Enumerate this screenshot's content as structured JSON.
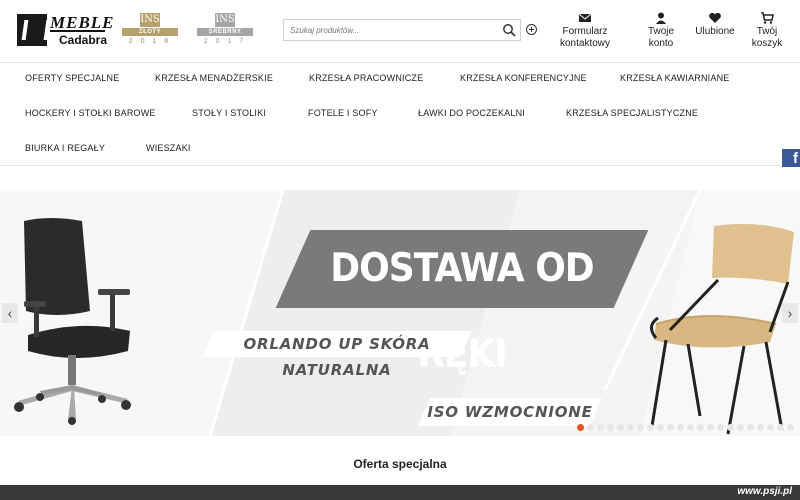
{
  "logo": {
    "line1": "MEBLE",
    "line2": "Cadabra"
  },
  "badges": [
    {
      "ins": "INS",
      "label": "ZŁOTY PARTNER",
      "year": "2 0 1 8"
    },
    {
      "ins": "INS",
      "label": "SREBRNY PARTNER",
      "year": "2 0 1 7"
    }
  ],
  "search": {
    "placeholder": "Szukaj produktów...",
    "value": ""
  },
  "header_links": {
    "contact": {
      "line1": "Formularz",
      "line2": "kontaktowy",
      "icon": "envelope-icon"
    },
    "account": {
      "line1": "Twoje",
      "line2": "konto",
      "icon": "user-icon"
    },
    "favorites": {
      "line1": "Ulubione",
      "icon": "heart-icon"
    },
    "cart": {
      "line1": "Twój",
      "line2": "koszyk",
      "icon": "cart-icon"
    }
  },
  "nav": [
    "OFERTY SPECJALNE",
    "KRZESŁA MENADŻERSKIE",
    "KRZESŁA PRACOWNICZE",
    "KRZESŁA KONFERENCYJNE",
    "KRZESŁA KAWIARNIANE",
    "HOCKERY I STOŁKI BAROWE",
    "STOŁY I STOLIKI",
    "FOTELE I SOFY",
    "ŁAWKI DO POCZEKALNI",
    "KRZESŁA SPECJALISTYCZNE",
    "BIURKA I REGAŁY",
    "WIESZAKI"
  ],
  "social": {
    "facebook": "f"
  },
  "slider": {
    "headline": "DOSTAWA OD RĘKI",
    "sub1": "ORLANDO UP SKÓRA NATURALNA",
    "sub2": "ISO WZMOCNIONE",
    "prev": "‹",
    "next": "›",
    "dot_count": 22,
    "active_dot": 0
  },
  "section_title": "Oferta specjalna",
  "watermark": "www.psji.pl",
  "colors": {
    "accent": "#e8561f",
    "facebook": "#3b5998",
    "banner": "#7a7a7a"
  }
}
